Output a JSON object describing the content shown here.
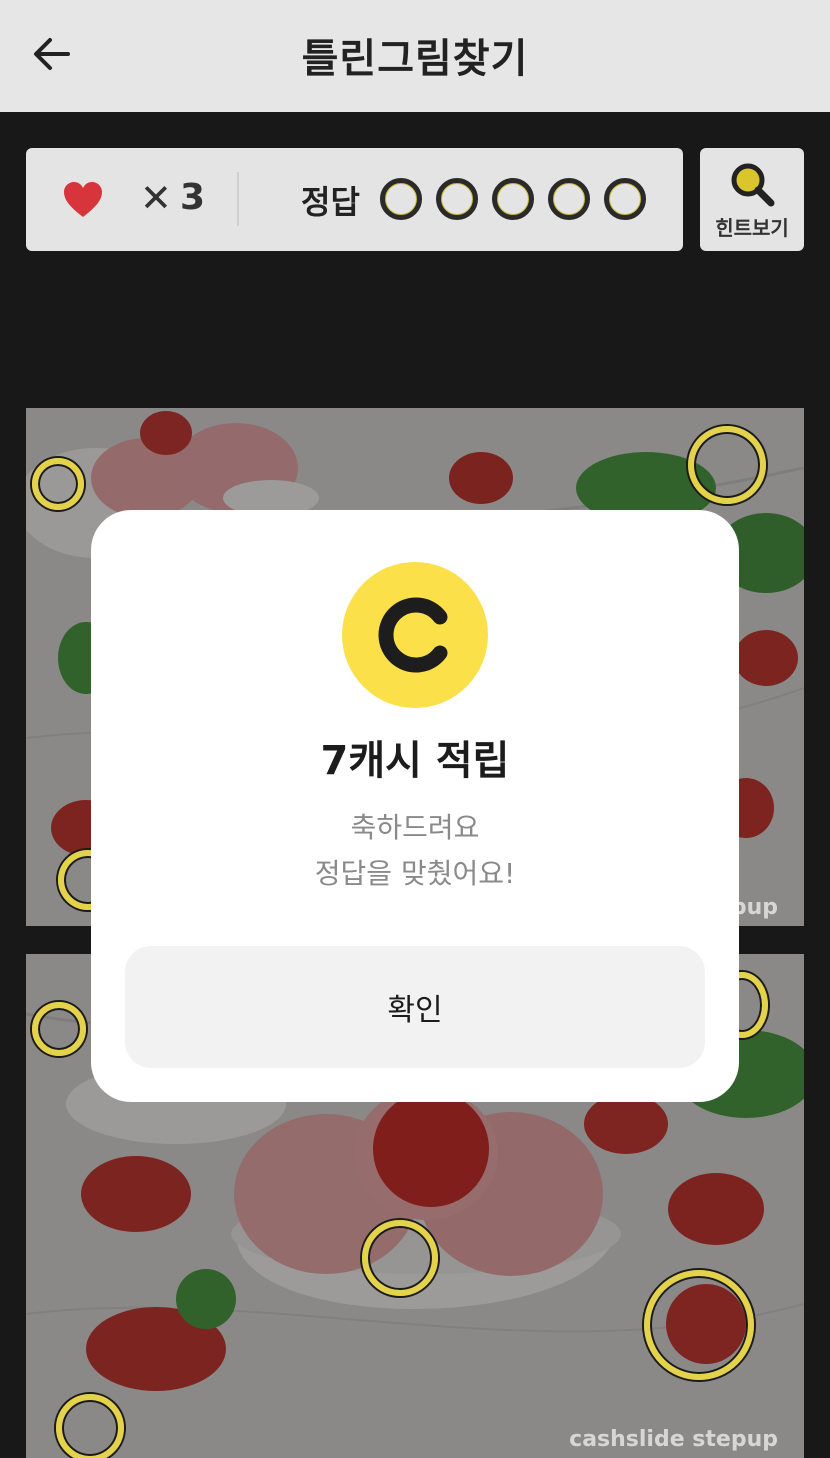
{
  "header": {
    "title": "틀린그림찾기"
  },
  "status": {
    "times_symbol": "✕",
    "lives": "3",
    "answer_label": "정답",
    "slot_count": 5
  },
  "hint": {
    "label": "힌트보기"
  },
  "photos": {
    "watermark": "cashslide stepup"
  },
  "modal": {
    "title": "7캐시 적립",
    "message_line1": "축하드려요",
    "message_line2": "정답을 맞췄어요!",
    "confirm_label": "확인"
  },
  "colors": {
    "coin": "#fbe04a",
    "marker": "#e3d24a",
    "heart": "#d8343c"
  }
}
